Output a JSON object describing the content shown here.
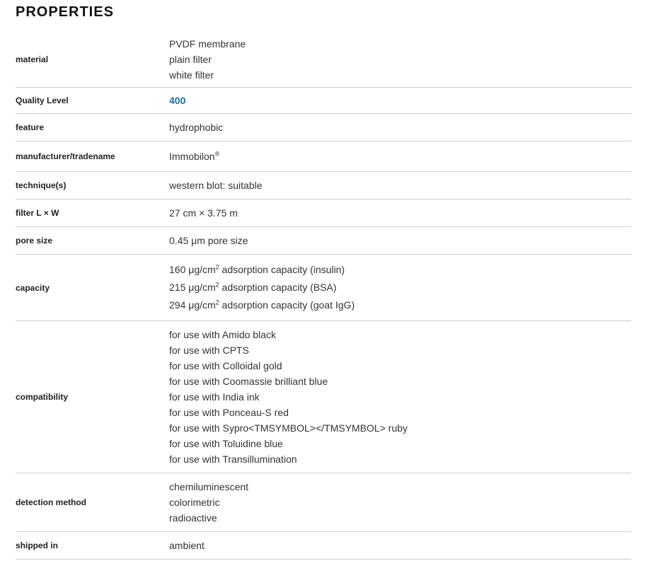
{
  "title": "PROPERTIES",
  "rows": [
    {
      "key": "material",
      "values": [
        "PVDF membrane",
        "plain filter",
        "white filter"
      ]
    },
    {
      "key": "Quality Level",
      "values": [
        "400"
      ]
    },
    {
      "key": "feature",
      "values": [
        "hydrophobic"
      ]
    },
    {
      "key": "manufacturer/tradename",
      "values": [
        "Immobilon"
      ],
      "sup": "®"
    },
    {
      "key": "technique(s)",
      "values": [
        "western blot: suitable"
      ]
    },
    {
      "key": "filter L × W",
      "values": [
        "27 cm × 3.75 m"
      ]
    },
    {
      "key": "pore size",
      "values": [
        "0.45 μm pore size"
      ]
    },
    {
      "key": "capacity",
      "values": [
        {
          "a": "160 μg/cm",
          "sup": "2",
          "b": " adsorption capacity (insulin)"
        },
        {
          "a": "215 μg/cm",
          "sup": "2",
          "b": " adsorption capacity (BSA)"
        },
        {
          "a": "294 μg/cm",
          "sup": "2",
          "b": " adsorption capacity (goat IgG)"
        }
      ]
    },
    {
      "key": "compatibility",
      "values": [
        "for use with Amido black",
        "for use with CPTS",
        "for use with Colloidal gold",
        "for use with Coomassie brilliant blue",
        "for use with India ink",
        "for use with Ponceau-S red",
        "for use with Sypro<TMSYMBOL></TMSYMBOL> ruby",
        "for use with Toluidine blue",
        "for use with Transillumination"
      ]
    },
    {
      "key": "detection method",
      "values": [
        "chemiluminescent",
        "colorimetric",
        "radioactive"
      ]
    },
    {
      "key": "shipped in",
      "values": [
        "ambient"
      ]
    }
  ]
}
